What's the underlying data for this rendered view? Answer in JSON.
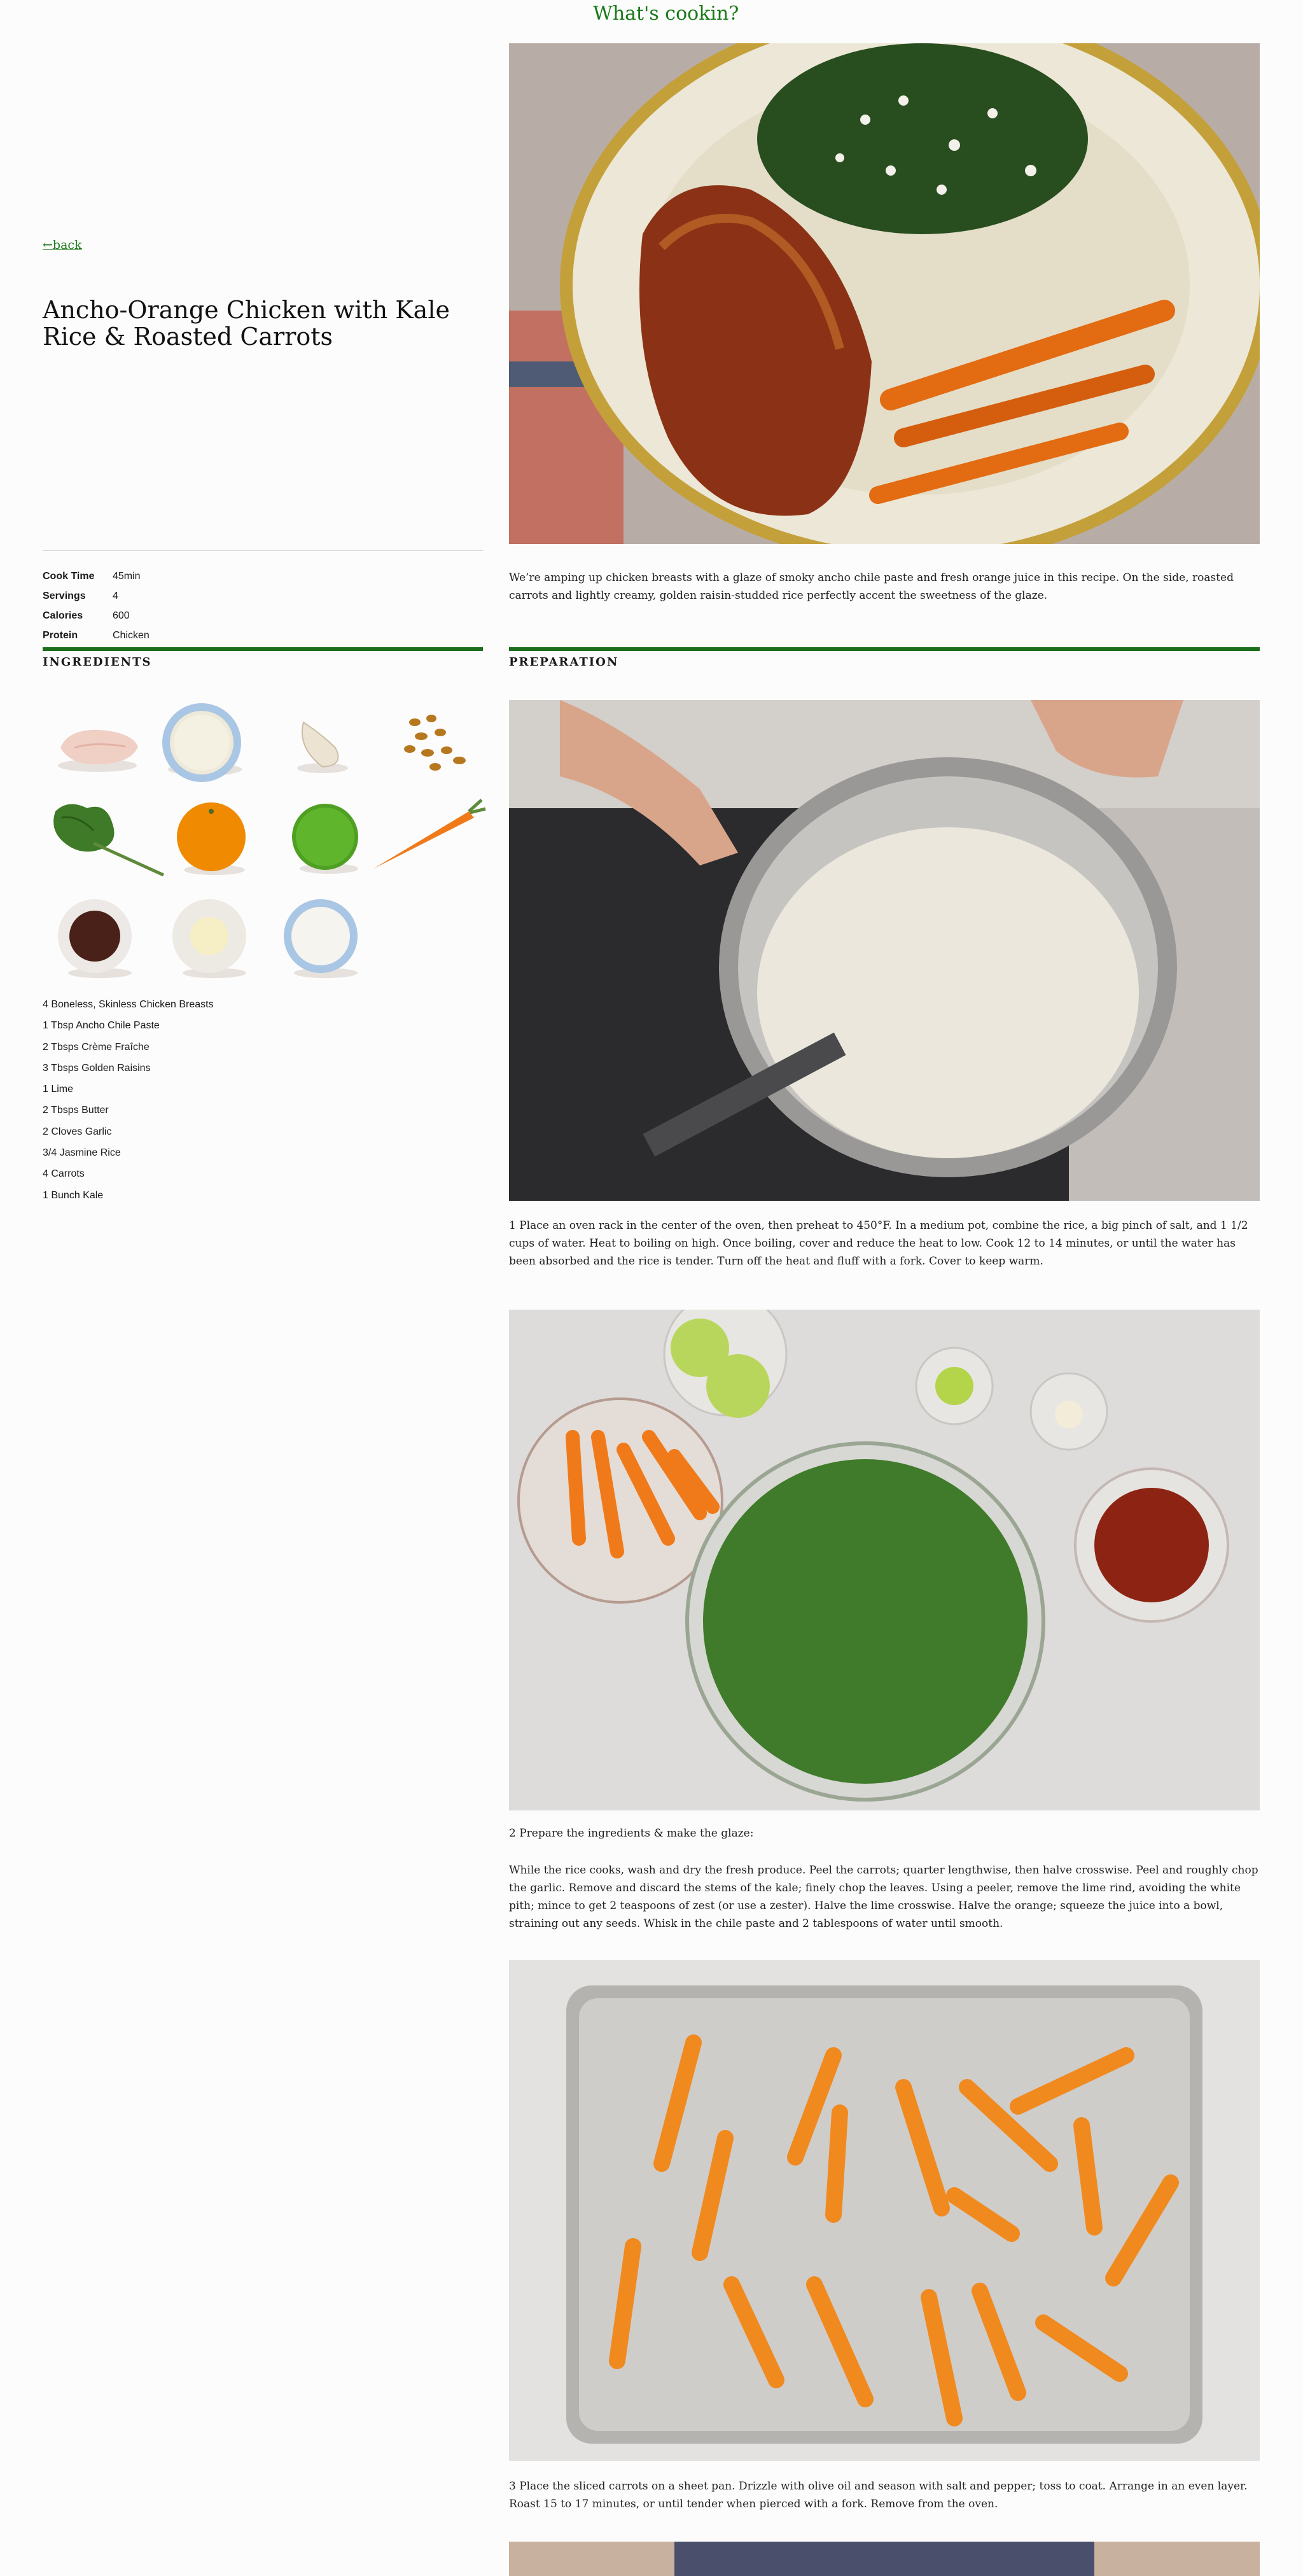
{
  "site": {
    "title": "What's cookin?"
  },
  "nav": {
    "back_label": "←back"
  },
  "recipe": {
    "title": "Ancho-Orange Chicken with Kale Rice & Roasted Carrots",
    "description": "We’re amping up chicken breasts with a glaze of smoky ancho chile paste and fresh orange juice in this recipe. On the side, roasted carrots and lightly creamy, golden raisin-studded rice perfectly accent the sweetness of the glaze."
  },
  "stats": [
    {
      "label": "Cook Time",
      "value": "45min"
    },
    {
      "label": "Servings",
      "value": "4"
    },
    {
      "label": "Calories",
      "value": "600"
    },
    {
      "label": "Protein",
      "value": "Chicken"
    }
  ],
  "sections": {
    "ingredients": "INGREDIENTS",
    "preparation": "PREPARATION"
  },
  "ingredients": [
    "4 Boneless, Skinless Chicken Breasts",
    "1 Tbsp Ancho Chile Paste",
    "2 Tbsps Crème Fraîche",
    "3 Tbsps Golden Raisins",
    "1 Lime",
    "2 Tbsps Butter",
    "2 Cloves Garlic",
    "3/4 Jasmine Rice",
    "4 Carrots",
    "1 Bunch Kale"
  ],
  "ingredient_icons": [
    "chicken-breast",
    "jasmine-rice",
    "garlic",
    "golden-raisins",
    "kale",
    "orange",
    "lime",
    "carrot",
    "ancho-chile-paste",
    "butter",
    "creme-fraiche"
  ],
  "steps": [
    {
      "text": "1 Place an oven rack in the center of the oven, then preheat to 450°F. In a medium pot, combine the rice, a big pinch of salt, and 1 1/2 cups of water. Heat to boiling on high. Once boiling, cover and reduce the heat to low. Cook 12 to 14 minutes, or until the water has been absorbed and the rice is tender. Turn off the heat and fluff with a fork. Cover to keep warm."
    },
    {
      "heading": "2 Prepare the ingredients & make the glaze:",
      "text": "While the rice cooks, wash and dry the fresh produce. Peel the carrots; quarter lengthwise, then halve crosswise. Peel and roughly chop the garlic. Remove and discard the stems of the kale; finely chop the leaves. Using a peeler, remove the lime rind, avoiding the white pith; mince to get 2 teaspoons of zest (or use a zester). Halve the lime crosswise. Halve the orange; squeeze the juice into a bowl, straining out any seeds. Whisk in the chile paste and 2 tablespoons of water until smooth."
    },
    {
      "text": "3 Place the sliced carrots on a sheet pan. Drizzle with olive oil and season with salt and pepper; toss to coat. Arrange in an even layer. Roast 15 to 17 minutes, or until tender when pierced with a fork. Remove from the oven."
    }
  ],
  "colors": {
    "accent_green": "#1d6e1d",
    "link_green": "#1a7a1a"
  }
}
